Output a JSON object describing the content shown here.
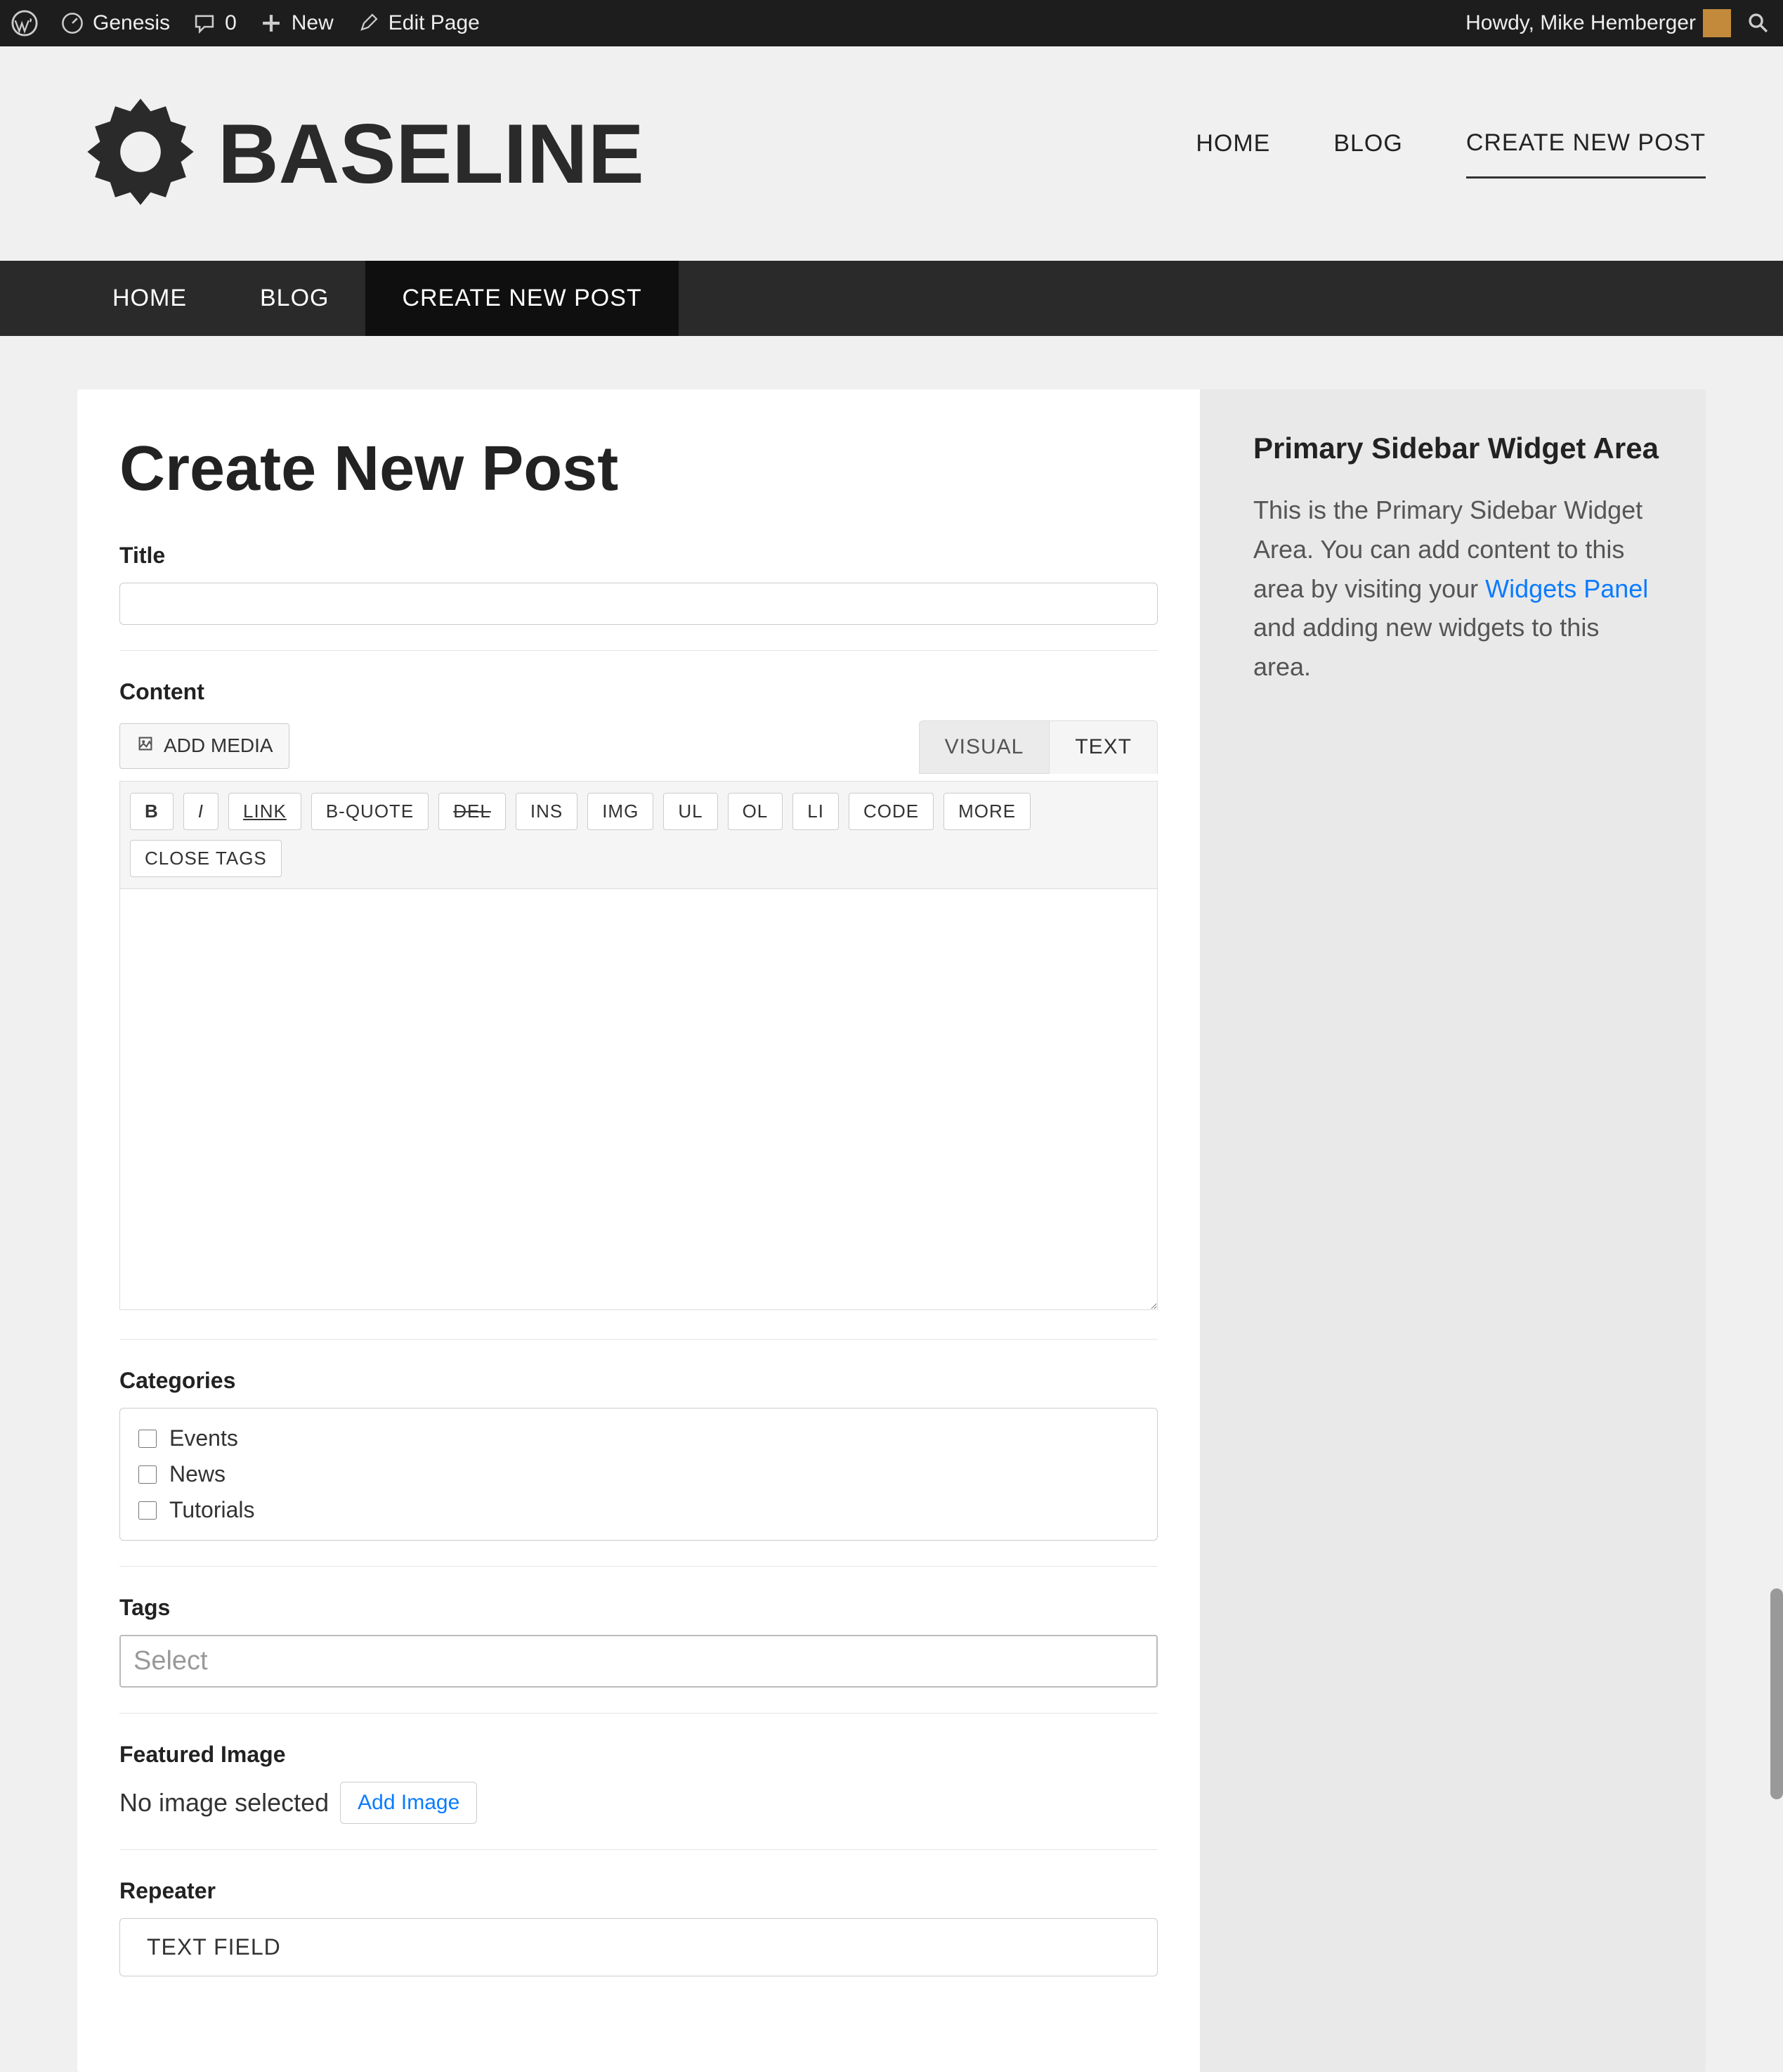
{
  "adminBar": {
    "siteName": "Genesis",
    "comments": "0",
    "newLabel": "New",
    "editPage": "Edit Page",
    "greeting": "Howdy, Mike Hemberger"
  },
  "site": {
    "logoText": "BASELINE"
  },
  "topNav": {
    "home": "HOME",
    "blog": "BLOG",
    "create": "CREATE NEW POST"
  },
  "darkNav": {
    "home": "HOME",
    "blog": "BLOG",
    "create": "CREATE NEW POST"
  },
  "page": {
    "title": "Create New Post"
  },
  "fields": {
    "titleLabel": "Title",
    "contentLabel": "Content",
    "categoriesLabel": "Categories",
    "tagsLabel": "Tags",
    "featuredLabel": "Featured Image",
    "repeaterLabel": "Repeater"
  },
  "editor": {
    "addMedia": "ADD MEDIA",
    "tabVisual": "VISUAL",
    "tabText": "TEXT",
    "quicktags": {
      "b": "B",
      "i": "I",
      "link": "LINK",
      "bquote": "B-QUOTE",
      "del": "DEL",
      "ins": "INS",
      "img": "IMG",
      "ul": "UL",
      "ol": "OL",
      "li": "LI",
      "code": "CODE",
      "more": "MORE",
      "close": "CLOSE TAGS"
    }
  },
  "categories": {
    "items": [
      "Events",
      "News",
      "Tutorials"
    ]
  },
  "tags": {
    "placeholder": "Select"
  },
  "featured": {
    "noImage": "No image selected",
    "addImage": "Add Image"
  },
  "repeater": {
    "textField": "TEXT FIELD"
  },
  "sidebar": {
    "title": "Primary Sidebar Widget Area",
    "text1": "This is the Primary Sidebar Widget Area. You can add content to this area by visiting your ",
    "link": "Widgets Panel",
    "text2": " and adding new widgets to this area."
  }
}
